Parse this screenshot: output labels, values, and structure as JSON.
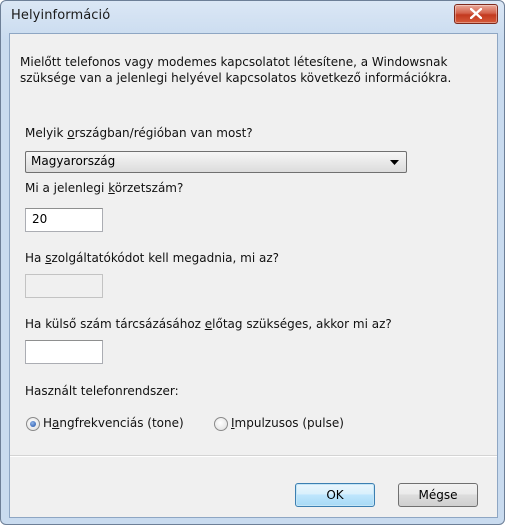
{
  "dialog": {
    "title": "Helyinformáció",
    "intro": "Mielőtt telefonos vagy modemes kapcsolatot létesítene, a Windowsnak szüksége van a jelenlegi helyével kapcsolatos következő információkra."
  },
  "country": {
    "label_pre": "Melyik ",
    "label_key": "o",
    "label_post": "rszágban/régióban van most?",
    "selected": "Magyarország"
  },
  "area_code": {
    "label_pre": "Mi a jelenlegi ",
    "label_key": "k",
    "label_post": "örzetszám?",
    "value": "20"
  },
  "carrier_code": {
    "label_pre": "Ha ",
    "label_key": "s",
    "label_post": "zolgáltatókódot kell megadnia, mi az?",
    "value": ""
  },
  "outside_line": {
    "label_pre": "Ha külső szám tárcsázásához ",
    "label_key": "e",
    "label_post": "lőtag szükséges, akkor mi az?",
    "value": ""
  },
  "phone_system": {
    "label": "Használt telefonrendszer:",
    "options": [
      {
        "label_pre": "H",
        "label_key": "a",
        "label_post": "ngfrekvenciás (tone)",
        "checked": true
      },
      {
        "label_pre": "",
        "label_key": "I",
        "label_post": "mpulzusos (pulse)",
        "checked": false
      }
    ]
  },
  "buttons": {
    "ok": "OK",
    "cancel": "Mégse"
  },
  "icons": {
    "close": "close-x-icon",
    "dropdown": "chevron-down-icon",
    "radio": "radio-button-icon"
  },
  "colors": {
    "close_button": "#c3391f",
    "title_bar": "#c9dbef",
    "default_button_border": "#3c7fb1"
  }
}
